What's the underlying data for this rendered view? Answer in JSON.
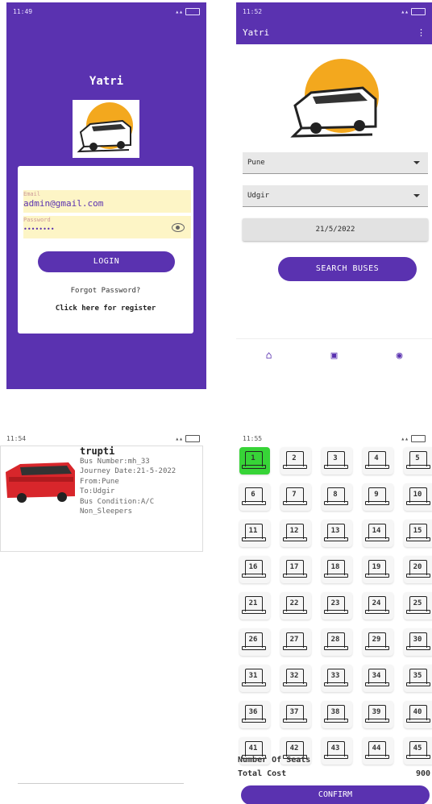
{
  "login": {
    "status_time": "11:49",
    "app_title": "Yatri",
    "email_label": "Email",
    "email_value": "admin@gmail.com",
    "password_label": "Password",
    "password_value": "••••••••",
    "login_button": "LOGIN",
    "forgot_password": "Forgot Password?",
    "register_link": "Click here for register"
  },
  "search": {
    "status_time": "11:52",
    "app_title": "Yatri",
    "overflow_icon": "⋮",
    "from_value": "Pune",
    "to_value": "Udgir",
    "date_value": "21/5/2022",
    "search_button": "SEARCH BUSES",
    "nav": [
      {
        "icon": "home-icon",
        "glyph": "⌂"
      },
      {
        "icon": "bus-icon",
        "glyph": "▣"
      },
      {
        "icon": "account-icon",
        "glyph": "◉"
      }
    ]
  },
  "buslist": {
    "status_time": "11:54",
    "operator": "trupti",
    "bus_number": "Bus Number:mh_33",
    "journey_date": "Journey Date:21-5-2022",
    "from": "From:Pune",
    "to": "To:Udgir",
    "condition": "Bus Condition:A/C",
    "type": "Non_Sleepers"
  },
  "seats": {
    "status_time": "11:55",
    "numbers": [
      "1",
      "2",
      "3",
      "4",
      "5",
      "6",
      "7",
      "8",
      "9",
      "10",
      "11",
      "12",
      "13",
      "14",
      "15",
      "16",
      "17",
      "18",
      "19",
      "20",
      "21",
      "22",
      "23",
      "24",
      "25",
      "26",
      "27",
      "28",
      "29",
      "30",
      "31",
      "32",
      "33",
      "34",
      "35",
      "36",
      "37",
      "38",
      "39",
      "40",
      "41",
      "42",
      "43",
      "44",
      "45"
    ],
    "selected": [
      "1"
    ],
    "num_seats_label": "Number Of Seats",
    "total_cost_label": "Total Cost",
    "total_cost_value": "900",
    "confirm_button": "CONFIRM"
  },
  "colors": {
    "primary": "#5a32b0",
    "selected_seat": "#37d437",
    "sun": "#f3a81e",
    "bus_red": "#d8262b"
  }
}
